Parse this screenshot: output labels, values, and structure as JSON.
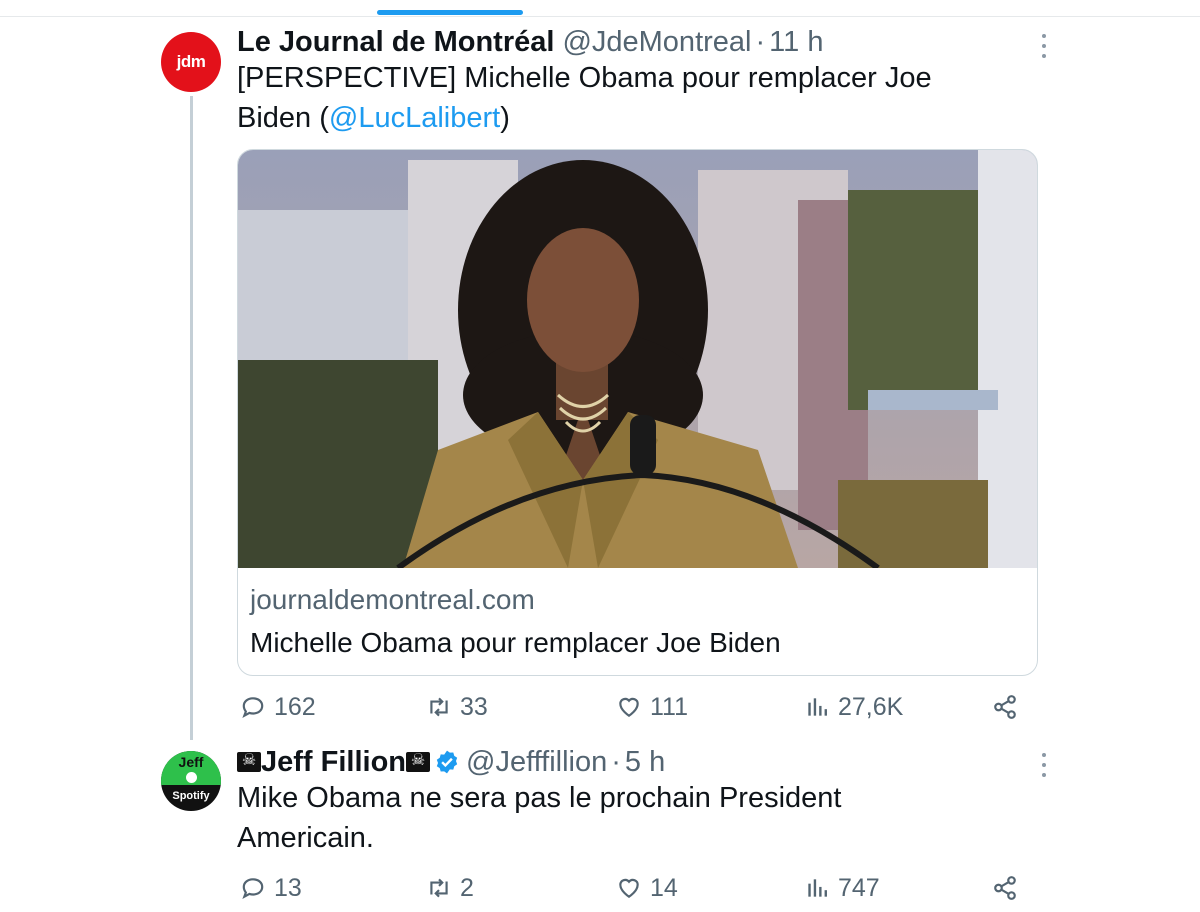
{
  "tweets": [
    {
      "avatar_text": "jdm",
      "name": "Le Journal de Montréal",
      "handle": "@JdeMontreal",
      "separator": "·",
      "time": "11 h",
      "text_line1": "[PERSPECTIVE] Michelle Obama pour remplacer Joe",
      "text_line2_prefix": "Biden (",
      "mention": "@LucLalibert",
      "text_line2_suffix": ")",
      "card": {
        "domain": "journaldemontreal.com",
        "title": "Michelle Obama pour remplacer Joe Biden"
      },
      "stats": {
        "replies": "162",
        "retweets": "33",
        "likes": "111",
        "views": "27,6K"
      }
    },
    {
      "avatar_text": "Jeff",
      "avatar_brand": "Spotify",
      "name": "Jeff Fillion",
      "handle": "@Jefffillion",
      "separator": "·",
      "time": "5 h",
      "text_line1": "Mike Obama ne sera pas le prochain President",
      "text_line2": "Americain.",
      "stats": {
        "replies": "13",
        "retweets": "2",
        "likes": "14",
        "views": "747"
      }
    }
  ],
  "colors": {
    "accent": "#1d9bf0",
    "jdm_red": "#e3111a",
    "muted": "#536471"
  },
  "icons": [
    "reply-icon",
    "retweet-icon",
    "like-icon",
    "views-icon",
    "share-icon",
    "more-icon",
    "verified-icon",
    "pirate-flag-icon"
  ]
}
